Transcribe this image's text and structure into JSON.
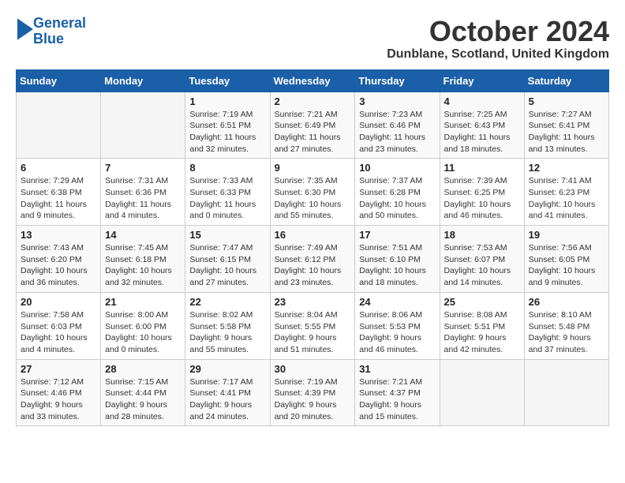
{
  "logo": {
    "line1": "General",
    "line2": "Blue"
  },
  "title": "October 2024",
  "location": "Dunblane, Scotland, United Kingdom",
  "days_of_week": [
    "Sunday",
    "Monday",
    "Tuesday",
    "Wednesday",
    "Thursday",
    "Friday",
    "Saturday"
  ],
  "weeks": [
    [
      {
        "num": "",
        "info": ""
      },
      {
        "num": "",
        "info": ""
      },
      {
        "num": "1",
        "info": "Sunrise: 7:19 AM\nSunset: 6:51 PM\nDaylight: 11 hours and 32 minutes."
      },
      {
        "num": "2",
        "info": "Sunrise: 7:21 AM\nSunset: 6:49 PM\nDaylight: 11 hours and 27 minutes."
      },
      {
        "num": "3",
        "info": "Sunrise: 7:23 AM\nSunset: 6:46 PM\nDaylight: 11 hours and 23 minutes."
      },
      {
        "num": "4",
        "info": "Sunrise: 7:25 AM\nSunset: 6:43 PM\nDaylight: 11 hours and 18 minutes."
      },
      {
        "num": "5",
        "info": "Sunrise: 7:27 AM\nSunset: 6:41 PM\nDaylight: 11 hours and 13 minutes."
      }
    ],
    [
      {
        "num": "6",
        "info": "Sunrise: 7:29 AM\nSunset: 6:38 PM\nDaylight: 11 hours and 9 minutes."
      },
      {
        "num": "7",
        "info": "Sunrise: 7:31 AM\nSunset: 6:36 PM\nDaylight: 11 hours and 4 minutes."
      },
      {
        "num": "8",
        "info": "Sunrise: 7:33 AM\nSunset: 6:33 PM\nDaylight: 11 hours and 0 minutes."
      },
      {
        "num": "9",
        "info": "Sunrise: 7:35 AM\nSunset: 6:30 PM\nDaylight: 10 hours and 55 minutes."
      },
      {
        "num": "10",
        "info": "Sunrise: 7:37 AM\nSunset: 6:28 PM\nDaylight: 10 hours and 50 minutes."
      },
      {
        "num": "11",
        "info": "Sunrise: 7:39 AM\nSunset: 6:25 PM\nDaylight: 10 hours and 46 minutes."
      },
      {
        "num": "12",
        "info": "Sunrise: 7:41 AM\nSunset: 6:23 PM\nDaylight: 10 hours and 41 minutes."
      }
    ],
    [
      {
        "num": "13",
        "info": "Sunrise: 7:43 AM\nSunset: 6:20 PM\nDaylight: 10 hours and 36 minutes."
      },
      {
        "num": "14",
        "info": "Sunrise: 7:45 AM\nSunset: 6:18 PM\nDaylight: 10 hours and 32 minutes."
      },
      {
        "num": "15",
        "info": "Sunrise: 7:47 AM\nSunset: 6:15 PM\nDaylight: 10 hours and 27 minutes."
      },
      {
        "num": "16",
        "info": "Sunrise: 7:49 AM\nSunset: 6:12 PM\nDaylight: 10 hours and 23 minutes."
      },
      {
        "num": "17",
        "info": "Sunrise: 7:51 AM\nSunset: 6:10 PM\nDaylight: 10 hours and 18 minutes."
      },
      {
        "num": "18",
        "info": "Sunrise: 7:53 AM\nSunset: 6:07 PM\nDaylight: 10 hours and 14 minutes."
      },
      {
        "num": "19",
        "info": "Sunrise: 7:56 AM\nSunset: 6:05 PM\nDaylight: 10 hours and 9 minutes."
      }
    ],
    [
      {
        "num": "20",
        "info": "Sunrise: 7:58 AM\nSunset: 6:03 PM\nDaylight: 10 hours and 4 minutes."
      },
      {
        "num": "21",
        "info": "Sunrise: 8:00 AM\nSunset: 6:00 PM\nDaylight: 10 hours and 0 minutes."
      },
      {
        "num": "22",
        "info": "Sunrise: 8:02 AM\nSunset: 5:58 PM\nDaylight: 9 hours and 55 minutes."
      },
      {
        "num": "23",
        "info": "Sunrise: 8:04 AM\nSunset: 5:55 PM\nDaylight: 9 hours and 51 minutes."
      },
      {
        "num": "24",
        "info": "Sunrise: 8:06 AM\nSunset: 5:53 PM\nDaylight: 9 hours and 46 minutes."
      },
      {
        "num": "25",
        "info": "Sunrise: 8:08 AM\nSunset: 5:51 PM\nDaylight: 9 hours and 42 minutes."
      },
      {
        "num": "26",
        "info": "Sunrise: 8:10 AM\nSunset: 5:48 PM\nDaylight: 9 hours and 37 minutes."
      }
    ],
    [
      {
        "num": "27",
        "info": "Sunrise: 7:12 AM\nSunset: 4:46 PM\nDaylight: 9 hours and 33 minutes."
      },
      {
        "num": "28",
        "info": "Sunrise: 7:15 AM\nSunset: 4:44 PM\nDaylight: 9 hours and 28 minutes."
      },
      {
        "num": "29",
        "info": "Sunrise: 7:17 AM\nSunset: 4:41 PM\nDaylight: 9 hours and 24 minutes."
      },
      {
        "num": "30",
        "info": "Sunrise: 7:19 AM\nSunset: 4:39 PM\nDaylight: 9 hours and 20 minutes."
      },
      {
        "num": "31",
        "info": "Sunrise: 7:21 AM\nSunset: 4:37 PM\nDaylight: 9 hours and 15 minutes."
      },
      {
        "num": "",
        "info": ""
      },
      {
        "num": "",
        "info": ""
      }
    ]
  ]
}
